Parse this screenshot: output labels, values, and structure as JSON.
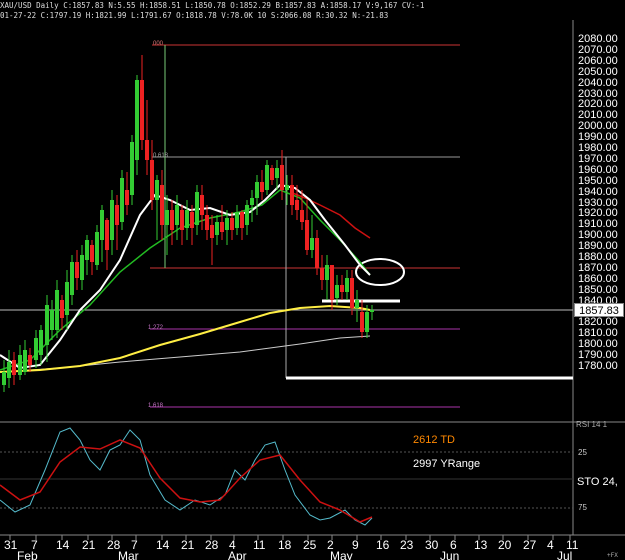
{
  "header": {
    "line1": "XAU/USD  Daily  C:1857.83  N:5.55  H:1858.51  L:1850.78  O:1852.29  B:1857.83  A:1858.17  V:9,167  CV:-1",
    "line2": "01-27-22  C:1797.19  H:1821.99  L:1791.67  O:1818.78  V:78.0K  10  S:2066.08  R:30.32  N:-21.83"
  },
  "price_axis": {
    "ticks": [
      "2080.00",
      "2070.00",
      "2060.00",
      "2050.00",
      "2040.00",
      "2030.00",
      "2020.00",
      "2010.00",
      "2000.00",
      "1990.00",
      "1980.00",
      "1970.00",
      "1960.00",
      "1950.00",
      "1940.00",
      "1930.00",
      "1920.00",
      "1910.00",
      "1900.00",
      "1890.00",
      "1880.00",
      "1870.00",
      "1860.00",
      "1850.00",
      "1840.00",
      "1830.00",
      "1820.00",
      "1810.00",
      "1800.00",
      "1790.00",
      "1780.00"
    ],
    "current_price": "1857.83"
  },
  "fib_labels": {
    "top": "000",
    "mid": "0.618",
    "lower": "1.272",
    "bottom": "1.618"
  },
  "indicator": {
    "td_label": "2612 TD",
    "range_label": "2997 YRange",
    "sto_label": "STO  24,",
    "tick_25": "25",
    "tick_75": "75",
    "top_cut_label": "RSI 14 1"
  },
  "x_axis": {
    "days": [
      "31",
      "7",
      "14",
      "21",
      "28",
      "7",
      "14",
      "21",
      "28",
      "4",
      "11",
      "18",
      "25",
      "2",
      "9",
      "16",
      "23",
      "30",
      "6",
      "13",
      "20",
      "27",
      "4",
      "11"
    ],
    "months": [
      "Feb",
      "Mar",
      "Apr",
      "May",
      "Jun",
      "Jul"
    ],
    "corner_mark": "+FX"
  },
  "colors": {
    "background": "#000000",
    "bull_candle": "#33cc33",
    "bear_candle": "#ee2222",
    "ma_white": "#ffffff",
    "ma_green": "#22bb22",
    "ma_yellow": "#ffee44",
    "ma_red": "#cc1111",
    "ma_gray": "#cccccc",
    "td_orange": "#ff8800",
    "stoch_cyan": "#55bbcc",
    "stoch_red": "#cc1111"
  }
}
